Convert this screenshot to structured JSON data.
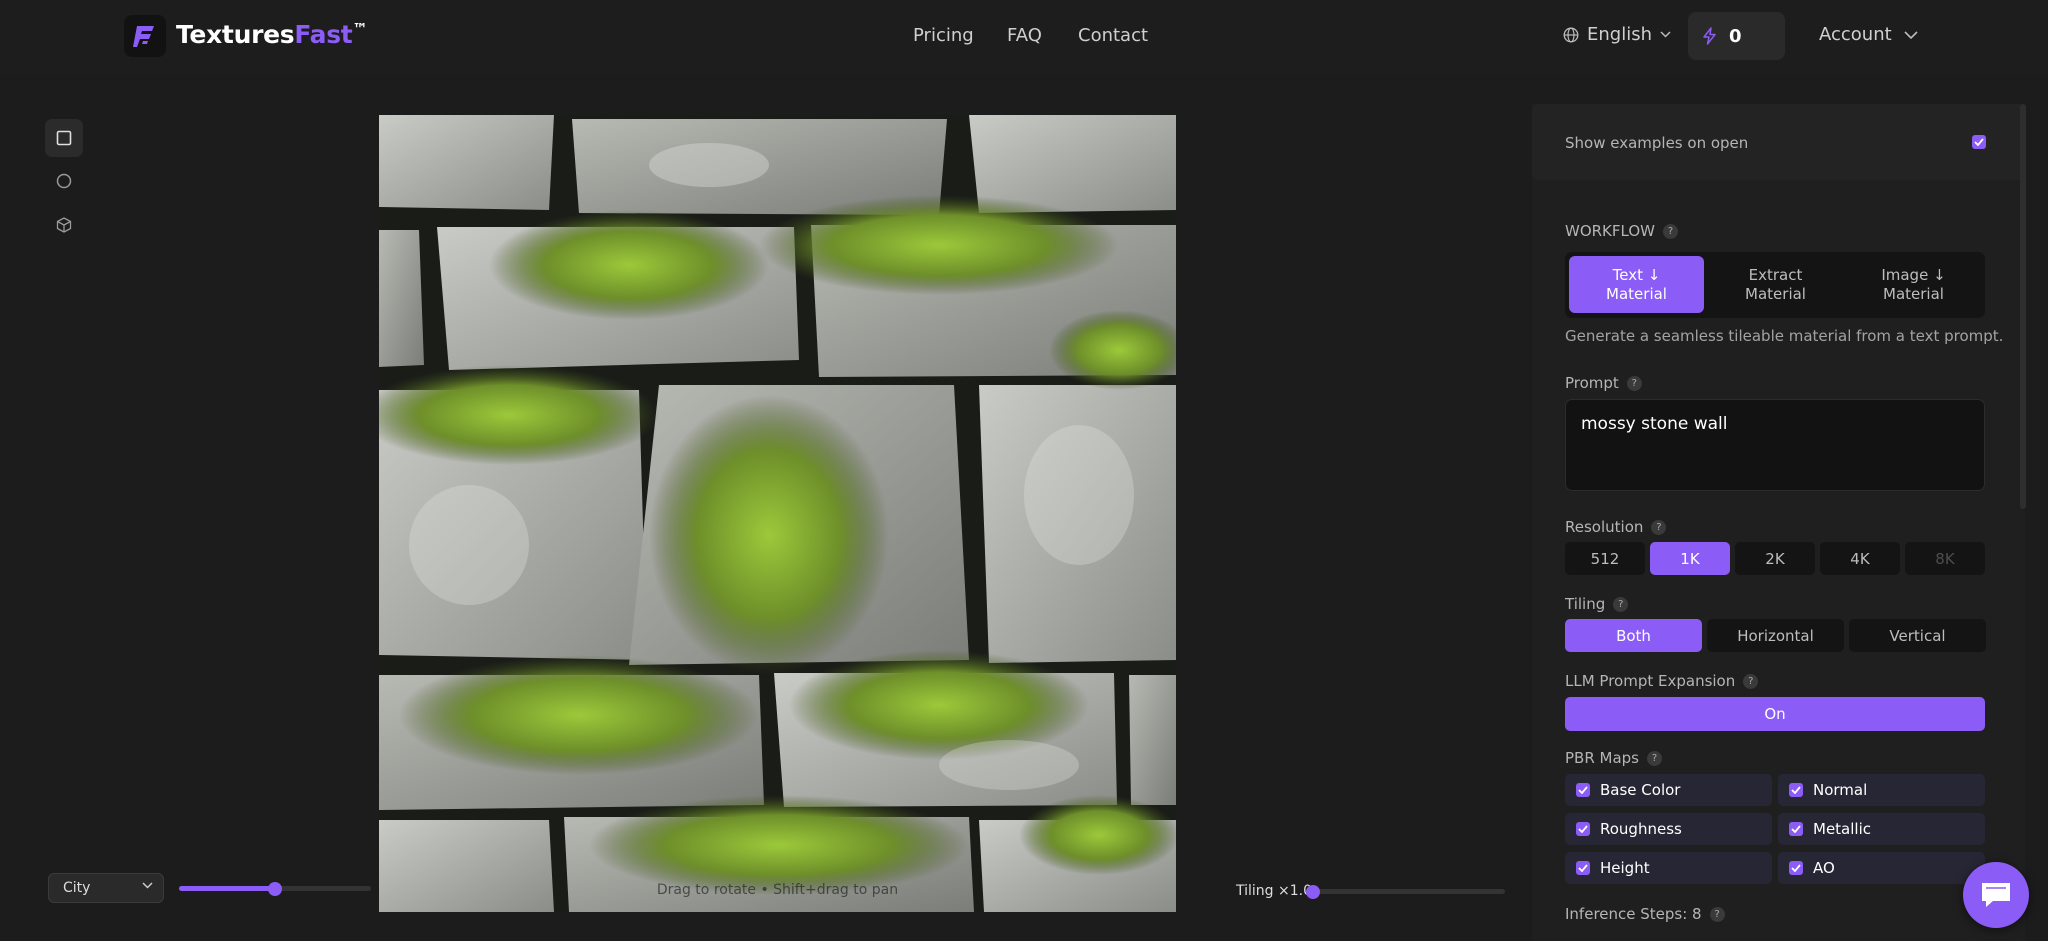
{
  "header": {
    "brand_main": "Textures",
    "brand_accent": "Fast",
    "brand_mark": "™",
    "nav": [
      "Pricing",
      "FAQ",
      "Contact"
    ],
    "language": "English",
    "credits": "0",
    "account": "Account"
  },
  "tools": [
    "square-view-icon",
    "sphere-view-icon",
    "cube-view-icon"
  ],
  "viewport": {
    "hint": "Drag to rotate • Shift+drag to pan",
    "environment": "City",
    "tiling_label": "Tiling ×1.0",
    "exposure_level": 0.5,
    "tiling_level": 0.0
  },
  "panel": {
    "show_examples": "Show examples on open",
    "workflow_label": "WORKFLOW",
    "workflow_modes": [
      {
        "line1": "Text ↓",
        "line2": "Material"
      },
      {
        "line1": "Extract",
        "line2": "Material"
      },
      {
        "line1": "Image ↓",
        "line2": "Material"
      }
    ],
    "workflow_description": "Generate a seamless tileable material from a text prompt.",
    "prompt_label": "Prompt",
    "prompt_value": "mossy stone wall",
    "resolution_label": "Resolution",
    "resolutions": [
      "512",
      "1K",
      "2K",
      "4K",
      "8K"
    ],
    "tiling_label": "Tiling",
    "tiling_options": [
      "Both",
      "Horizontal",
      "Vertical"
    ],
    "llm_label": "LLM Prompt Expansion",
    "llm_value": "On",
    "pbr_label": "PBR Maps",
    "pbr_maps": [
      "Base Color",
      "Normal",
      "Roughness",
      "Metallic",
      "Height",
      "AO"
    ],
    "inference_label": "Inference Steps: 8"
  },
  "colors": {
    "accent": "#8b5cf6",
    "background": "#1c1c1c"
  }
}
